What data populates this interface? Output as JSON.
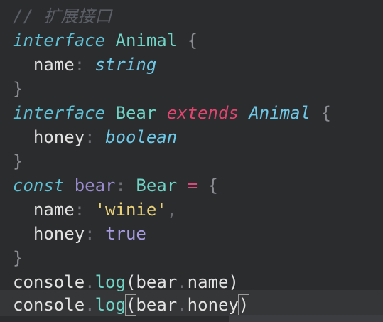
{
  "editor": {
    "lines": [
      {
        "tokens": [
          {
            "t": "// 扩展接口",
            "c": "comment"
          }
        ]
      },
      {
        "tokens": [
          {
            "t": "interface",
            "c": "kw"
          },
          {
            "t": " ",
            "c": "plain"
          },
          {
            "t": "Animal",
            "c": "type"
          },
          {
            "t": " {",
            "c": "brace"
          }
        ]
      },
      {
        "tokens": [
          {
            "t": "  name",
            "c": "prop"
          },
          {
            "t": ":",
            "c": "punct"
          },
          {
            "t": " ",
            "c": "plain"
          },
          {
            "t": "string",
            "c": "builtin"
          }
        ]
      },
      {
        "tokens": [
          {
            "t": "}",
            "c": "brace"
          }
        ]
      },
      {
        "tokens": [
          {
            "t": "interface",
            "c": "kw"
          },
          {
            "t": " ",
            "c": "plain"
          },
          {
            "t": "Bear",
            "c": "type"
          },
          {
            "t": " ",
            "c": "plain"
          },
          {
            "t": "extends",
            "c": "ext"
          },
          {
            "t": " ",
            "c": "plain"
          },
          {
            "t": "Animal",
            "c": "builtin"
          },
          {
            "t": " {",
            "c": "brace"
          }
        ]
      },
      {
        "tokens": [
          {
            "t": "  honey",
            "c": "prop"
          },
          {
            "t": ":",
            "c": "punct"
          },
          {
            "t": " ",
            "c": "plain"
          },
          {
            "t": "boolean",
            "c": "builtin"
          }
        ]
      },
      {
        "tokens": [
          {
            "t": "}",
            "c": "brace"
          }
        ]
      },
      {
        "tokens": [
          {
            "t": "const",
            "c": "kw"
          },
          {
            "t": " ",
            "c": "plain"
          },
          {
            "t": "bear",
            "c": "var"
          },
          {
            "t": ":",
            "c": "punct"
          },
          {
            "t": " ",
            "c": "plain"
          },
          {
            "t": "Bear",
            "c": "type"
          },
          {
            "t": " ",
            "c": "plain"
          },
          {
            "t": "=",
            "c": "op"
          },
          {
            "t": " {",
            "c": "brace"
          }
        ]
      },
      {
        "tokens": [
          {
            "t": "  name",
            "c": "prop"
          },
          {
            "t": ":",
            "c": "punct"
          },
          {
            "t": " ",
            "c": "plain"
          },
          {
            "t": "'winie'",
            "c": "str"
          },
          {
            "t": ",",
            "c": "punct"
          }
        ]
      },
      {
        "tokens": [
          {
            "t": "  honey",
            "c": "prop"
          },
          {
            "t": ":",
            "c": "punct"
          },
          {
            "t": " ",
            "c": "plain"
          },
          {
            "t": "true",
            "c": "bool"
          }
        ]
      },
      {
        "tokens": [
          {
            "t": "}",
            "c": "brace"
          }
        ]
      },
      {
        "tokens": [
          {
            "t": "console",
            "c": "plain"
          },
          {
            "t": ".",
            "c": "punct"
          },
          {
            "t": "log",
            "c": "func"
          },
          {
            "t": "(",
            "c": "plain"
          },
          {
            "t": "bear",
            "c": "plain"
          },
          {
            "t": ".",
            "c": "punct"
          },
          {
            "t": "name",
            "c": "plain"
          },
          {
            "t": ")",
            "c": "plain"
          }
        ]
      },
      {
        "tokens": [
          {
            "t": "console",
            "c": "plain"
          },
          {
            "t": ".",
            "c": "punct"
          },
          {
            "t": "log",
            "c": "func"
          },
          {
            "t": "(",
            "c": "plain bracket-hl"
          },
          {
            "t": "bear",
            "c": "plain"
          },
          {
            "t": ".",
            "c": "punct"
          },
          {
            "t": "honey",
            "c": "plain"
          },
          {
            "t": ")",
            "c": "plain bracket-hl"
          }
        ]
      }
    ]
  }
}
